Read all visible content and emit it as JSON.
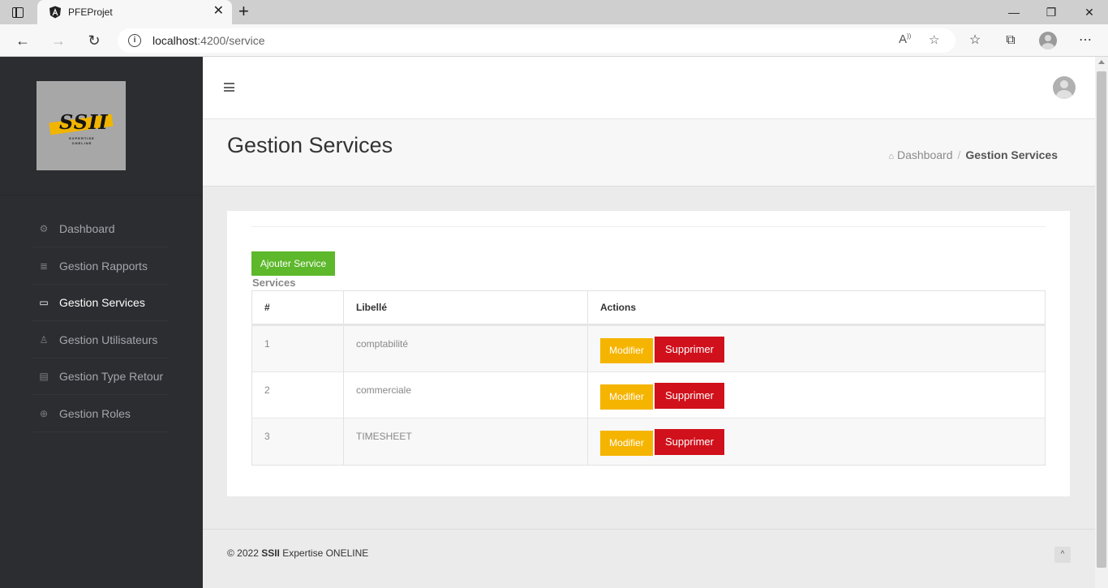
{
  "browser": {
    "tab_title": "PFEProjet",
    "tab_close": "✕",
    "new_tab": "+",
    "window_minimize": "—",
    "window_restore": "❐",
    "window_close": "✕",
    "url_host": "localhost",
    "url_path": ":4200/service",
    "icons": [
      "tab-actions-icon",
      "angular-logo-icon",
      "back-icon",
      "forward-icon",
      "refresh-icon",
      "site-info-icon",
      "read-aloud-icon",
      "add-favorite-icon",
      "favorites-icon",
      "collections-icon",
      "profile-icon",
      "more-options-icon"
    ]
  },
  "sidebar": {
    "logo_text": "SSII",
    "logo_sub": "EXPERTISE ONELINE",
    "items": [
      {
        "label": "Dashboard",
        "icon": "dashboard-icon",
        "active": false
      },
      {
        "label": "Gestion Rapports",
        "icon": "database-icon",
        "active": false
      },
      {
        "label": "Gestion Services",
        "icon": "monitor-icon",
        "active": true
      },
      {
        "label": "Gestion Utilisateurs",
        "icon": "user-icon",
        "active": false
      },
      {
        "label": "Gestion Type Retour",
        "icon": "list-icon",
        "active": false
      },
      {
        "label": "Gestion Roles",
        "icon": "globe-icon",
        "active": false
      }
    ]
  },
  "header": {
    "page_title": "Gestion Services",
    "breadcrumb": {
      "home": "Dashboard",
      "current": "Gestion Services"
    }
  },
  "main": {
    "add_button": "Ajouter Service",
    "table_caption": "Services",
    "columns": [
      "#",
      "Libellé",
      "Actions"
    ],
    "rows": [
      {
        "id": "1",
        "libelle": "comptabilité",
        "modify": "Modifier",
        "delete": "Supprimer"
      },
      {
        "id": "2",
        "libelle": "commerciale",
        "modify": "Modifier",
        "delete": "Supprimer"
      },
      {
        "id": "3",
        "libelle": "TIMESHEET",
        "modify": "Modifier",
        "delete": "Supprimer"
      }
    ]
  },
  "footer": {
    "prefix": "© 2022 ",
    "brand": "SSII",
    "suffix": " Expertise ONELINE",
    "scroll_top": "^"
  },
  "colors": {
    "sidebar_bg": "#2b2d30",
    "add_button": "#5db82b",
    "modify_button": "#f5b400",
    "delete_button": "#d0101b",
    "logo_accent": "#f1b500"
  }
}
